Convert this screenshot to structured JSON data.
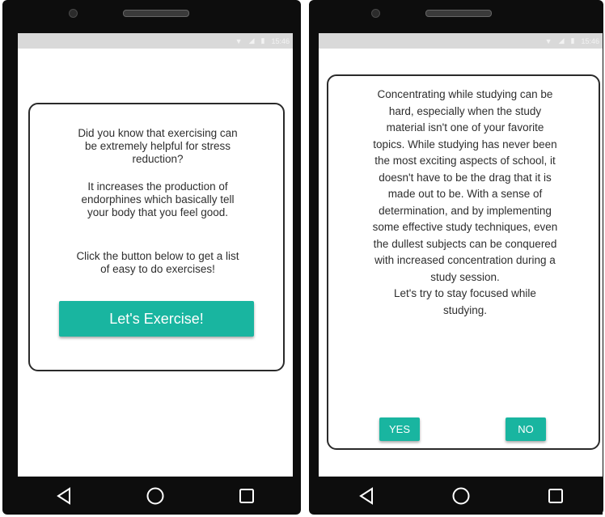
{
  "status_bar": {
    "time": "15:46",
    "icons": [
      "wifi-icon",
      "signal-icon",
      "battery-icon"
    ]
  },
  "left_screen": {
    "paragraph1": "Did you know that exercising can be extremely helpful for stress reduction?",
    "paragraph2": "It increases the production of endorphines which basically tell your body that you feel good.",
    "paragraph3": "Click the button below to get a list of easy to do exercises!",
    "button_label": "Let's Exercise!"
  },
  "right_screen": {
    "body": "Concentrating while studying can be hard, especially when the study material isn't one of your favorite topics. While studying has never been the most exciting aspects of school, it doesn't have to be the drag that it is made out to be. With a sense of determination, and by implementing some effective study techniques, even the dullest subjects can be conquered with increased concentration during a study session.\nLet's try to stay focused while studying.",
    "yes_label": "YES",
    "no_label": "NO"
  },
  "nav": {
    "icons": [
      "back-icon",
      "home-icon",
      "recents-icon"
    ]
  },
  "colors": {
    "accent": "#19b5a0",
    "status_bar": "#d9d9d9",
    "frame": "#0d0d0d"
  }
}
